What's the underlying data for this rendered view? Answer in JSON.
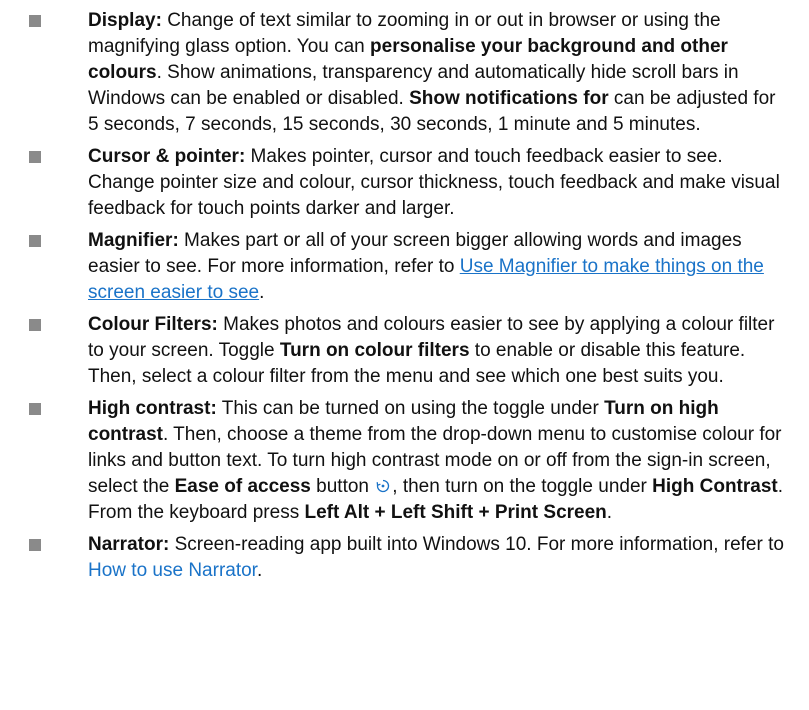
{
  "items": [
    {
      "name": "display",
      "parts": [
        {
          "t": "Display:",
          "s": "b"
        },
        {
          "t": " Change of text similar to zooming in or out in browser or using the magnifying glass option. You can "
        },
        {
          "t": "personalise your background and other colours",
          "s": "b"
        },
        {
          "t": ". Show animations, transparency and automatically hide scroll bars in Windows can be enabled or disabled. "
        },
        {
          "t": "Show notifications for",
          "s": "b"
        },
        {
          "t": " can be adjusted for 5 seconds, 7 seconds, 15 seconds, 30 seconds, 1 minute and 5 minutes."
        }
      ]
    },
    {
      "name": "cursor-pointer",
      "parts": [
        {
          "t": "Cursor & pointer:",
          "s": "b"
        },
        {
          "t": " Makes pointer, cursor and touch feedback easier to see. Change pointer size and colour, cursor thickness, touch feedback and make visual feedback for touch points darker and larger."
        }
      ]
    },
    {
      "name": "magnifier",
      "parts": [
        {
          "t": "Magnifier:",
          "s": "b"
        },
        {
          "t": " Makes part or all of your screen bigger allowing words and images easier to see. For more information, refer to "
        },
        {
          "t": "Use Magnifier to make things on the screen easier to see",
          "s": "link-u"
        },
        {
          "t": "."
        }
      ]
    },
    {
      "name": "colour-filters",
      "parts": [
        {
          "t": "Colour Filters:",
          "s": "b"
        },
        {
          "t": " Makes photos and colours easier to see by applying a colour filter to your screen. Toggle "
        },
        {
          "t": "Turn on colour filters",
          "s": "b"
        },
        {
          "t": " to enable or disable this feature. Then, select a colour filter from the menu and see which one best suits you."
        }
      ]
    },
    {
      "name": "high-contrast",
      "parts": [
        {
          "t": "High contrast:",
          "s": "b"
        },
        {
          "t": " This can be turned on using the toggle under "
        },
        {
          "t": "Turn on high contrast",
          "s": "b"
        },
        {
          "t": ". Then, choose a theme from the drop-down menu to customise colour for links and button text. To turn high contrast mode on or off from the sign-in screen, select the "
        },
        {
          "t": "Ease of access",
          "s": "b"
        },
        {
          "t": " button "
        },
        {
          "s": "icon",
          "icon": "ease-of-access-icon"
        },
        {
          "t": ", then turn on the toggle under "
        },
        {
          "t": "High Contrast",
          "s": "b"
        },
        {
          "t": ". From the keyboard press "
        },
        {
          "t": "Left Alt + Left Shift + Print Screen",
          "s": "b"
        },
        {
          "t": "."
        }
      ]
    },
    {
      "name": "narrator",
      "parts": [
        {
          "t": "Narrator:",
          "s": "b"
        },
        {
          "t": " Screen-reading app built into Windows 10. For more information, refer to "
        },
        {
          "t": "How to use Narrator",
          "s": "link"
        },
        {
          "t": "."
        }
      ]
    }
  ],
  "colors": {
    "text": "#111111",
    "link": "#1a73c8",
    "bullet": "#8a8a8a"
  }
}
